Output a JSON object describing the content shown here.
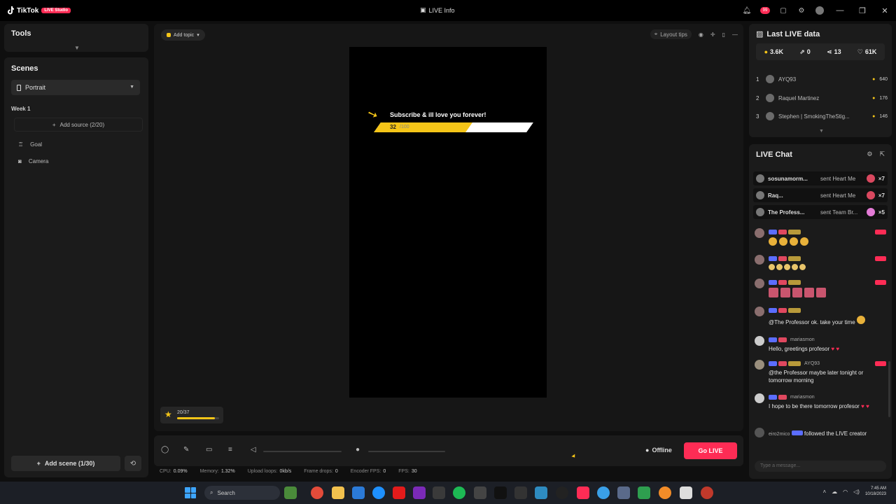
{
  "titlebar": {
    "app_name": "TikTok",
    "badge": "LIVE Studio",
    "center_title": "LIVE Info",
    "notif_count": "99",
    "controls": [
      "—",
      "❐",
      "✕"
    ]
  },
  "tools": {
    "title": "Tools"
  },
  "scenes": {
    "title": "Scenes",
    "selected_layout": "Portrait",
    "scene_name": "Week 1",
    "add_source_label": "Add source (2/20)",
    "sources": [
      {
        "icon": "goal-icon",
        "label": "Goal"
      },
      {
        "icon": "camera-icon",
        "label": "Camera"
      }
    ],
    "add_scene_label": "Add scene (1/30)"
  },
  "preview": {
    "add_topic_label": "Add topic",
    "layout_tips_label": "Layout tips",
    "goal": {
      "title": "Subscribe & ill love you forever!",
      "current": "32",
      "target": "/100",
      "progress": 0.6
    },
    "mini_widget": {
      "label": "20/37",
      "progress": 0.9
    }
  },
  "controls": {
    "offline_label": "Offline",
    "go_live_label": "Go LIVE"
  },
  "stats": [
    {
      "label": "CPU:",
      "value": "0.09%"
    },
    {
      "label": "Memory:",
      "value": "1.32%"
    },
    {
      "label": "Upload loops:",
      "value": "0kb/s"
    },
    {
      "label": "Frame drops:",
      "value": "0"
    },
    {
      "label": "Encoder FPS:",
      "value": "0"
    },
    {
      "label": "FPS:",
      "value": "30"
    }
  ],
  "last_live": {
    "title": "Last LIVE data",
    "metrics": [
      {
        "icon": "coin-icon",
        "value": "3.6K"
      },
      {
        "icon": "share-icon",
        "value": "0"
      },
      {
        "icon": "repost-icon",
        "value": "13"
      },
      {
        "icon": "heart-icon",
        "value": "61K"
      }
    ],
    "ranking": [
      {
        "rank": "1",
        "name": "AYQ93",
        "coins": "640"
      },
      {
        "rank": "2",
        "name": "Raquel Martinez",
        "coins": "176"
      },
      {
        "rank": "3",
        "name": "Stephen | SmokingTheStig...",
        "coins": "146"
      }
    ]
  },
  "chat": {
    "title": "LIVE Chat",
    "gifts": [
      {
        "name": "sosunamorm...",
        "action": "sent Heart Me",
        "count": "×7"
      },
      {
        "name": "Raq...",
        "action": "sent Heart Me",
        "count": "×7"
      },
      {
        "name": "The Profess...",
        "action": "sent Team Br...",
        "count": "×5"
      }
    ],
    "messages": [
      {
        "user": "",
        "text": ""
      },
      {
        "user": "",
        "text": ""
      },
      {
        "user": "",
        "text": ""
      },
      {
        "user": "",
        "text": "@The Professor ok. take your time"
      },
      {
        "user": "mariasmon",
        "text": "Hello, greetings profesor"
      },
      {
        "user": "AYQ93",
        "text": "@the Professor maybe later tonight or tomorrow morning"
      },
      {
        "user": "mariasmon",
        "text": "I hope to be there tomorrow profesor"
      },
      {
        "user": "eiro2mico",
        "text": "followed the LIVE creator"
      }
    ],
    "input_placeholder": "Type a message..."
  },
  "taskbar": {
    "search_label": "Search",
    "clock_time": "7:45 AM",
    "clock_date": "10/18/2023"
  }
}
